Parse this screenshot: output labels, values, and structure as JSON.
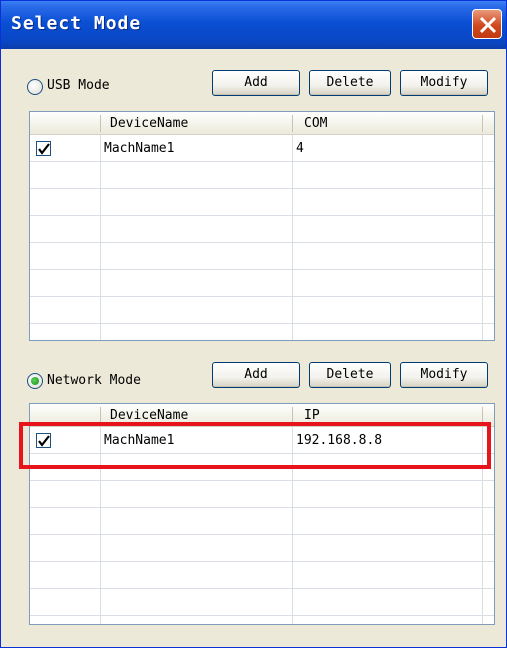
{
  "window": {
    "title": "Select Mode",
    "close_icon": "close-x-icon",
    "close_color": "#d2491f"
  },
  "usb": {
    "label": "USB Mode",
    "selected": false,
    "buttons": {
      "add": "Add",
      "delete": "Delete",
      "modify": "Modify"
    },
    "columns": [
      "",
      "DeviceName",
      "COM"
    ],
    "rows": [
      {
        "checked": true,
        "name": "MachName1",
        "value": "4"
      }
    ]
  },
  "network": {
    "label": "Network Mode",
    "selected": true,
    "buttons": {
      "add": "Add",
      "delete": "Delete",
      "modify": "Modify"
    },
    "columns": [
      "",
      "DeviceName",
      "IP"
    ],
    "rows": [
      {
        "checked": true,
        "name": "MachName1",
        "value": "192.168.8.8"
      }
    ]
  },
  "colors": {
    "title_bar": "#0a4fd4",
    "highlight": "#e8141b"
  }
}
